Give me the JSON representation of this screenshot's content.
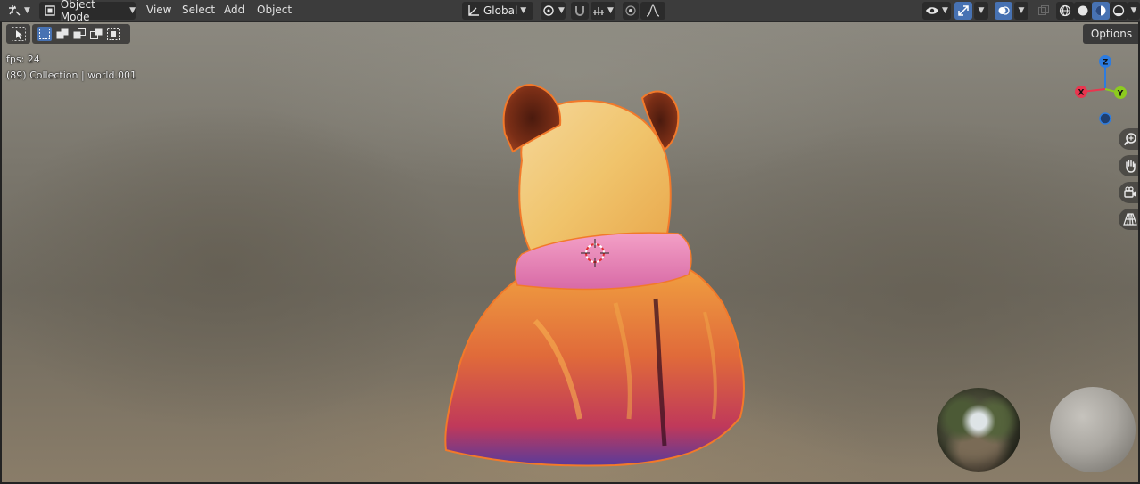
{
  "header": {
    "mode_label": "Object Mode",
    "menus": [
      "View",
      "Select",
      "Add",
      "Object"
    ],
    "transform_orientation": "Global"
  },
  "options_label": "Options",
  "overlay": {
    "fps_text": "fps: 24",
    "collection_text": "(89) Collection | world.001"
  },
  "gizmo": {
    "axes": [
      "Z",
      "X",
      "Y"
    ],
    "colors": {
      "x": "#e8364f",
      "y": "#8ccb1f",
      "z": "#2d7ce0"
    }
  },
  "colors": {
    "header_bg": "#3c3c3c",
    "active_blue": "#4772b3",
    "selection_outline": "#f2792a"
  },
  "icons": {
    "editor_type": "editor-type-icon",
    "mode": "object-mode-icon",
    "orientation": "transform-orientation-icon",
    "pivot": "pivot-point-icon",
    "snap": "snap-magnet-icon",
    "snap_target": "snap-increment-icon",
    "proportional": "proportional-edit-icon",
    "falloff": "falloff-curve-icon",
    "visibility": "eye-visibility-icon",
    "gizmos": "gizmo-toggle-icon",
    "overlays": "overlay-toggle-icon",
    "xray": "xray-toggle-icon",
    "wireframe": "wireframe-shading-icon",
    "solid": "solid-shading-icon",
    "material": "material-preview-icon",
    "rendered": "rendered-shading-icon",
    "zoom": "zoom-icon",
    "pan": "hand-pan-icon",
    "camera": "camera-view-icon",
    "perspective": "perspective-grid-icon"
  }
}
